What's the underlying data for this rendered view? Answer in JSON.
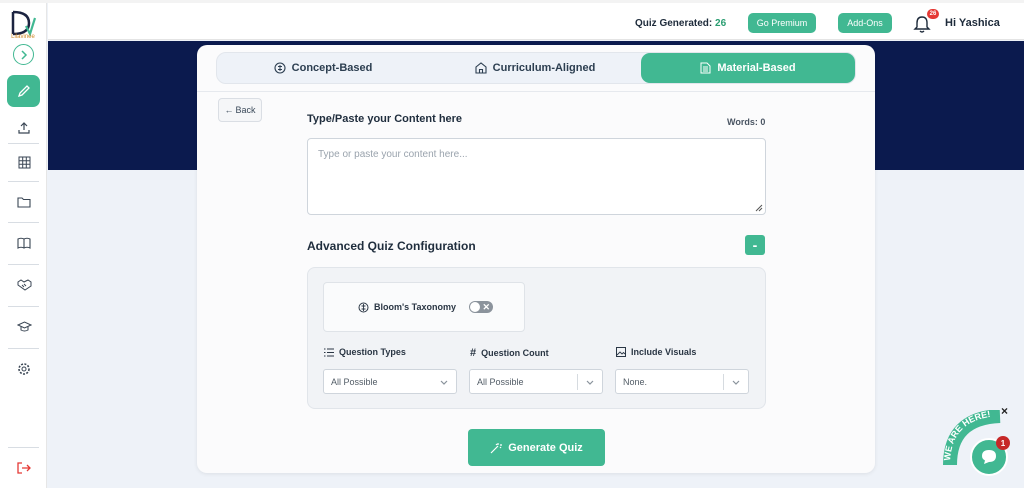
{
  "brand": {
    "logo_text": "Lilavinee"
  },
  "header": {
    "quiz_generated_label": "Quiz Generated:",
    "quiz_generated_count": "26",
    "go_premium": "Go Premium",
    "add_ons": "Add-Ons",
    "notification_count": "26",
    "greeting": "Hi Yashica"
  },
  "sidebar": {
    "items": [
      {
        "name": "edit",
        "icon": "pencil-icon"
      },
      {
        "name": "upload",
        "icon": "upload-icon"
      },
      {
        "name": "table",
        "icon": "grid-icon"
      },
      {
        "name": "folder",
        "icon": "folder-icon"
      },
      {
        "name": "book",
        "icon": "book-icon"
      },
      {
        "name": "handshake",
        "icon": "handshake-icon"
      },
      {
        "name": "graduation",
        "icon": "graduation-cap-icon"
      },
      {
        "name": "settings",
        "icon": "gear-icon"
      },
      {
        "name": "logout",
        "icon": "logout-icon"
      }
    ]
  },
  "tabs": [
    {
      "label": "Concept-Based",
      "active": false
    },
    {
      "label": "Curriculum-Aligned",
      "active": false
    },
    {
      "label": "Material-Based",
      "active": true
    }
  ],
  "back_label": "Back",
  "content": {
    "label": "Type/Paste your Content here",
    "words_label": "Words: 0",
    "placeholder": "Type or paste your content here..."
  },
  "advanced": {
    "title": "Advanced Quiz Configuration",
    "collapse_symbol": "-",
    "bloom_label": "Bloom's Taxonomy",
    "bloom_enabled": false,
    "question_types_label": "Question Types",
    "question_types_value": "All Possible",
    "question_count_label": "Question Count",
    "question_count_value": "All Possible",
    "include_visuals_label": "Include Visuals",
    "include_visuals_value": "None."
  },
  "generate_label": "Generate Quiz",
  "chat": {
    "banner_text": "WE ARE HERE!",
    "badge": "1",
    "close": "×"
  },
  "colors": {
    "accent": "#41b892",
    "banner": "#0b1a4e",
    "badge": "#e53935"
  }
}
